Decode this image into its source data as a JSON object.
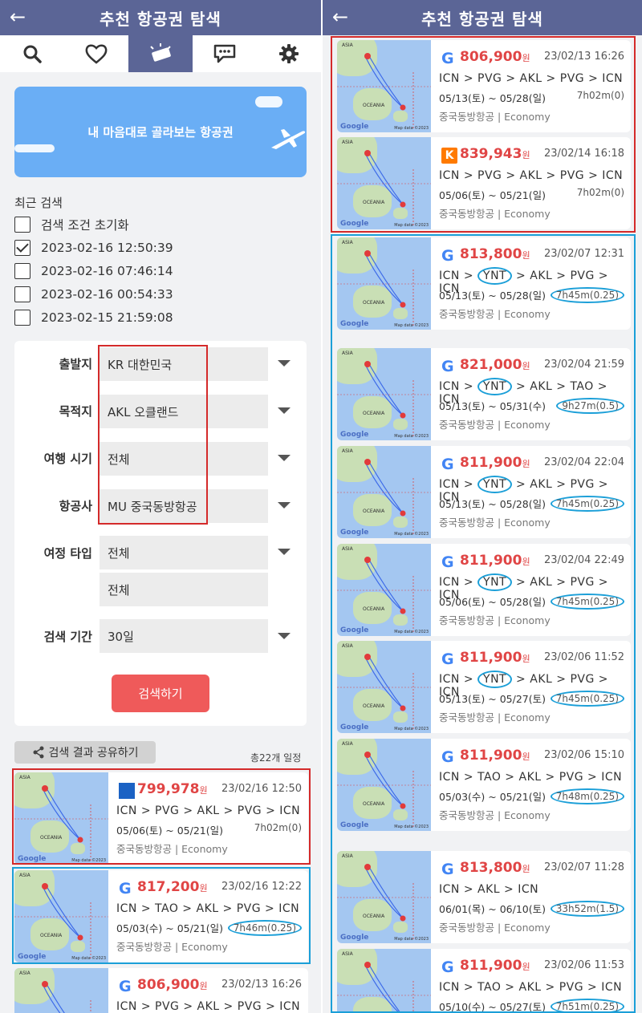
{
  "header": {
    "title": "추천 항공권 탐색",
    "back": "←"
  },
  "banner": {
    "text": "내 마음대로 골라보는 항공권"
  },
  "recent": {
    "title": "최근 검색",
    "items": [
      {
        "label": "검색 조건 초기화",
        "checked": false
      },
      {
        "label": "2023-02-16 12:50:39",
        "checked": true
      },
      {
        "label": "2023-02-16 07:46:14",
        "checked": false
      },
      {
        "label": "2023-02-16 00:54:33",
        "checked": false
      },
      {
        "label": "2023-02-15 21:59:08",
        "checked": false
      }
    ]
  },
  "form": {
    "origin_label": "출발지",
    "origin_value": "KR 대한민국",
    "dest_label": "목적지",
    "dest_value": "AKL 오클랜드",
    "time_label": "여행 시기",
    "time_value": "전체",
    "airline_label": "항공사",
    "airline_value": "MU 중국동방항공",
    "trip_label": "여정 타입",
    "trip_value1": "전체",
    "trip_value2": "전체",
    "period_label": "검색 기간",
    "period_value": "30일",
    "search_button": "검색하기"
  },
  "results": {
    "share_label": "검색 결과 공유하기",
    "count": "총22개 일정"
  },
  "map": {
    "asia": "ASIA",
    "oceania": "OCEANIA",
    "google": "Google",
    "mapdata": "Map data ©2023"
  },
  "left_cards": [
    {
      "logo": "s",
      "logo_text": "",
      "price": "799,978",
      "won": "원",
      "date": "23/02/16 12:50",
      "route": [
        "ICN",
        "PVG",
        "AKL",
        "PVG",
        "ICN"
      ],
      "period": "05/06(토) ~ 05/21(일)",
      "duration": "7h02m(0)",
      "airline": "중국동방항공 | Economy"
    },
    {
      "logo": "g",
      "logo_text": "G",
      "price": "817,200",
      "won": "원",
      "date": "23/02/16 12:22",
      "route": [
        "ICN",
        "TAO",
        "AKL",
        "PVG",
        "ICN"
      ],
      "period": "05/03(수) ~ 05/21(일)",
      "duration": "7h46m(0.25)",
      "airline": "중국동방항공 | Economy"
    },
    {
      "logo": "g",
      "logo_text": "G",
      "price": "806,900",
      "won": "원",
      "date": "23/02/13 16:26",
      "route": [
        "ICN",
        "PVG",
        "AKL",
        "PVG",
        "ICN"
      ],
      "period": "",
      "duration": "",
      "airline": ""
    }
  ],
  "right_cards": [
    {
      "logo": "g",
      "logo_text": "G",
      "price": "806,900",
      "won": "원",
      "date": "23/02/13 16:26",
      "route": [
        "ICN",
        "PVG",
        "AKL",
        "PVG",
        "ICN"
      ],
      "period": "05/13(토) ~ 05/28(일)",
      "duration": "7h02m(0)",
      "airline": "중국동방항공 | Economy"
    },
    {
      "logo": "k",
      "logo_text": "K",
      "price": "839,943",
      "won": "원",
      "date": "23/02/14 16:18",
      "route": [
        "ICN",
        "PVG",
        "AKL",
        "PVG",
        "ICN"
      ],
      "period": "05/06(토) ~ 05/21(일)",
      "duration": "7h02m(0)",
      "airline": "중국동방항공 | Economy"
    },
    {
      "logo": "g",
      "logo_text": "G",
      "price": "813,800",
      "won": "원",
      "date": "23/02/07 12:31",
      "route": [
        "ICN",
        "YNT",
        "AKL",
        "PVG",
        "ICN"
      ],
      "period": "05/13(토) ~ 05/28(일)",
      "duration": "7h45m(0.25)",
      "airline": "중국동방항공 | Economy"
    },
    {
      "logo": "g",
      "logo_text": "G",
      "price": "821,000",
      "won": "원",
      "date": "23/02/04 21:59",
      "route": [
        "ICN",
        "YNT",
        "AKL",
        "TAO",
        "ICN"
      ],
      "period": "05/13(토) ~ 05/31(수)",
      "duration": "9h27m(0.5)",
      "airline": "중국동방항공 | Economy"
    },
    {
      "logo": "g",
      "logo_text": "G",
      "price": "811,900",
      "won": "원",
      "date": "23/02/04 22:04",
      "route": [
        "ICN",
        "YNT",
        "AKL",
        "PVG",
        "ICN"
      ],
      "period": "05/13(토) ~ 05/28(일)",
      "duration": "7h45m(0.25)",
      "airline": "중국동방항공 | Economy"
    },
    {
      "logo": "g",
      "logo_text": "G",
      "price": "811,900",
      "won": "원",
      "date": "23/02/04 22:49",
      "route": [
        "ICN",
        "YNT",
        "AKL",
        "PVG",
        "ICN"
      ],
      "period": "05/06(토) ~ 05/28(일)",
      "duration": "7h45m(0.25)",
      "airline": "중국동방항공 | Economy"
    },
    {
      "logo": "g",
      "logo_text": "G",
      "price": "811,900",
      "won": "원",
      "date": "23/02/06 11:52",
      "route": [
        "ICN",
        "YNT",
        "AKL",
        "PVG",
        "ICN"
      ],
      "period": "05/13(토) ~ 05/27(토)",
      "duration": "7h45m(0.25)",
      "airline": "중국동방항공 | Economy"
    },
    {
      "logo": "g",
      "logo_text": "G",
      "price": "811,900",
      "won": "원",
      "date": "23/02/06 15:10",
      "route": [
        "ICN",
        "TAO",
        "AKL",
        "PVG",
        "ICN"
      ],
      "period": "05/03(수) ~ 05/21(일)",
      "duration": "7h48m(0.25)",
      "airline": "중국동방항공 | Economy"
    },
    {
      "logo": "g",
      "logo_text": "G",
      "price": "813,800",
      "won": "원",
      "date": "23/02/07 11:28",
      "route": [
        "ICN",
        "AKL",
        "ICN"
      ],
      "period": "06/01(목) ~ 06/10(토)",
      "duration": "33h52m(1.5)",
      "airline": "중국동방항공 | Economy"
    },
    {
      "logo": "g",
      "logo_text": "G",
      "price": "811,900",
      "won": "원",
      "date": "23/02/06 11:53",
      "route": [
        "ICN",
        "TAO",
        "AKL",
        "PVG",
        "ICN"
      ],
      "period": "05/10(수) ~ 05/27(토)",
      "duration": "7h51m(0.25)",
      "airline": ""
    }
  ]
}
